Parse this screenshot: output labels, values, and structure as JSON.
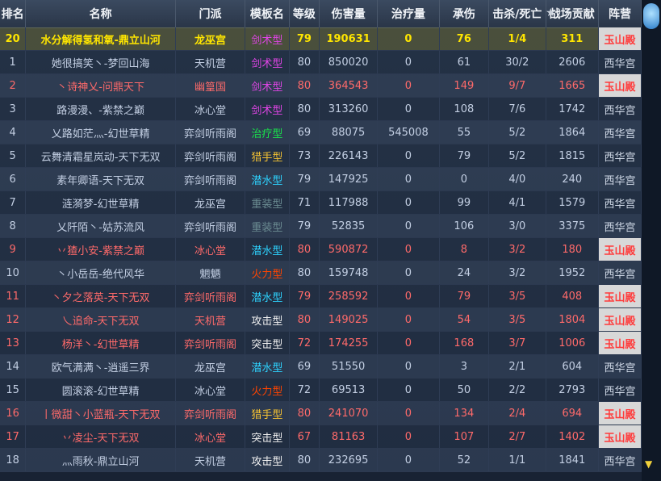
{
  "header": {
    "rank": "排名",
    "name": "名称",
    "sect": "门派",
    "template": "模板名",
    "level": "等级",
    "damage": "伤害量",
    "heal": "治疗量",
    "tank": "承伤",
    "kd": "击杀/死亡",
    "contribution": "战场贡献",
    "camp": "阵营"
  },
  "rows": [
    {
      "rank": "20",
      "name": "水分解得氢和氧-鼎立山河",
      "sect": "龙巫宫",
      "template": "剑术型",
      "level": "79",
      "damage": "190631",
      "heal": "0",
      "tank": "76",
      "kd": "1/4",
      "contribution": "311",
      "camp": "玉山殿"
    },
    {
      "rank": "1",
      "name": "她很搞笑丶-梦回山海",
      "sect": "天机营",
      "template": "剑术型",
      "level": "80",
      "damage": "850020",
      "heal": "0",
      "tank": "61",
      "kd": "30/2",
      "contribution": "2606",
      "camp": "西华宫"
    },
    {
      "rank": "2",
      "name": "丶诗神乂-问鼎天下",
      "sect": "幽篁国",
      "template": "剑术型",
      "level": "80",
      "damage": "364543",
      "heal": "0",
      "tank": "149",
      "kd": "9/7",
      "contribution": "1665",
      "camp": "玉山殿"
    },
    {
      "rank": "3",
      "name": "路漫漫、-紫禁之巅",
      "sect": "冰心堂",
      "template": "剑术型",
      "level": "80",
      "damage": "313260",
      "heal": "0",
      "tank": "108",
      "kd": "7/6",
      "contribution": "1742",
      "camp": "西华宫"
    },
    {
      "rank": "4",
      "name": "乂路如茫灬-幻世草精",
      "sect": "弈剑听雨阁",
      "template": "治疗型",
      "level": "69",
      "damage": "88075",
      "heal": "545008",
      "tank": "55",
      "kd": "5/2",
      "contribution": "1864",
      "camp": "西华宫"
    },
    {
      "rank": "5",
      "name": "云舞清霜星岚动-天下无双",
      "sect": "弈剑听雨阁",
      "template": "猎手型",
      "level": "73",
      "damage": "226143",
      "heal": "0",
      "tank": "79",
      "kd": "5/2",
      "contribution": "1815",
      "camp": "西华宫"
    },
    {
      "rank": "6",
      "name": "素年卿语-天下无双",
      "sect": "弈剑听雨阁",
      "template": "潜水型",
      "level": "79",
      "damage": "147925",
      "heal": "0",
      "tank": "0",
      "kd": "4/0",
      "contribution": "240",
      "camp": "西华宫"
    },
    {
      "rank": "7",
      "name": "涟漪梦-幻世草精",
      "sect": "龙巫宫",
      "template": "重装型",
      "level": "71",
      "damage": "117988",
      "heal": "0",
      "tank": "99",
      "kd": "4/1",
      "contribution": "1579",
      "camp": "西华宫"
    },
    {
      "rank": "8",
      "name": "乂阡陌丶-姑苏流风",
      "sect": "弈剑听雨阁",
      "template": "重装型",
      "level": "79",
      "damage": "52835",
      "heal": "0",
      "tank": "106",
      "kd": "3/0",
      "contribution": "3375",
      "camp": "西华宫"
    },
    {
      "rank": "9",
      "name": "丷猹小安-紫禁之巅",
      "sect": "冰心堂",
      "template": "潜水型",
      "level": "80",
      "damage": "590872",
      "heal": "0",
      "tank": "8",
      "kd": "3/2",
      "contribution": "180",
      "camp": "玉山殿"
    },
    {
      "rank": "10",
      "name": "丶小岳岳-绝代风华",
      "sect": "魍魉",
      "template": "火力型",
      "level": "80",
      "damage": "159748",
      "heal": "0",
      "tank": "24",
      "kd": "3/2",
      "contribution": "1952",
      "camp": "西华宫"
    },
    {
      "rank": "11",
      "name": "丶夕之落英-天下无双",
      "sect": "弈剑听雨阁",
      "template": "潜水型",
      "level": "79",
      "damage": "258592",
      "heal": "0",
      "tank": "79",
      "kd": "3/5",
      "contribution": "408",
      "camp": "玉山殿"
    },
    {
      "rank": "12",
      "name": "乀追命-天下无双",
      "sect": "天机营",
      "template": "攻击型",
      "level": "80",
      "damage": "149025",
      "heal": "0",
      "tank": "54",
      "kd": "3/5",
      "contribution": "1804",
      "camp": "玉山殿"
    },
    {
      "rank": "13",
      "name": "杨洋丶-幻世草精",
      "sect": "弈剑听雨阁",
      "template": "突击型",
      "level": "72",
      "damage": "174255",
      "heal": "0",
      "tank": "168",
      "kd": "3/7",
      "contribution": "1006",
      "camp": "玉山殿"
    },
    {
      "rank": "14",
      "name": "欧气满满丶-逍遥三界",
      "sect": "龙巫宫",
      "template": "潜水型",
      "level": "69",
      "damage": "51550",
      "heal": "0",
      "tank": "3",
      "kd": "2/1",
      "contribution": "604",
      "camp": "西华宫"
    },
    {
      "rank": "15",
      "name": "圆滚滚-幻世草精",
      "sect": "冰心堂",
      "template": "火力型",
      "level": "72",
      "damage": "69513",
      "heal": "0",
      "tank": "50",
      "kd": "2/2",
      "contribution": "2793",
      "camp": "西华宫"
    },
    {
      "rank": "16",
      "name": "丨微甜丶小蓝瓶-天下无双",
      "sect": "弈剑听雨阁",
      "template": "猎手型",
      "level": "80",
      "damage": "241070",
      "heal": "0",
      "tank": "134",
      "kd": "2/4",
      "contribution": "694",
      "camp": "玉山殿"
    },
    {
      "rank": "17",
      "name": "丷凌尘-天下无双",
      "sect": "冰心堂",
      "template": "突击型",
      "level": "67",
      "damage": "81163",
      "heal": "0",
      "tank": "107",
      "kd": "2/7",
      "contribution": "1402",
      "camp": "玉山殿"
    },
    {
      "rank": "18",
      "name": "灬雨秋-鼎立山河",
      "sect": "天机营",
      "template": "攻击型",
      "level": "80",
      "damage": "232695",
      "heal": "0",
      "tank": "52",
      "kd": "1/1",
      "contribution": "1841",
      "camp": "西华宫"
    }
  ],
  "colors": {
    "header_bg": "#33425a",
    "self_row": "#ffe600",
    "xihua": "#c3cfe3",
    "yushan": "#ff6a6a",
    "yushan_badge": "#ff3b3b"
  },
  "icons": {
    "scroll_up": "scroll-up-icon",
    "scroll_down": "scroll-down-icon",
    "sort": "star-icon"
  }
}
